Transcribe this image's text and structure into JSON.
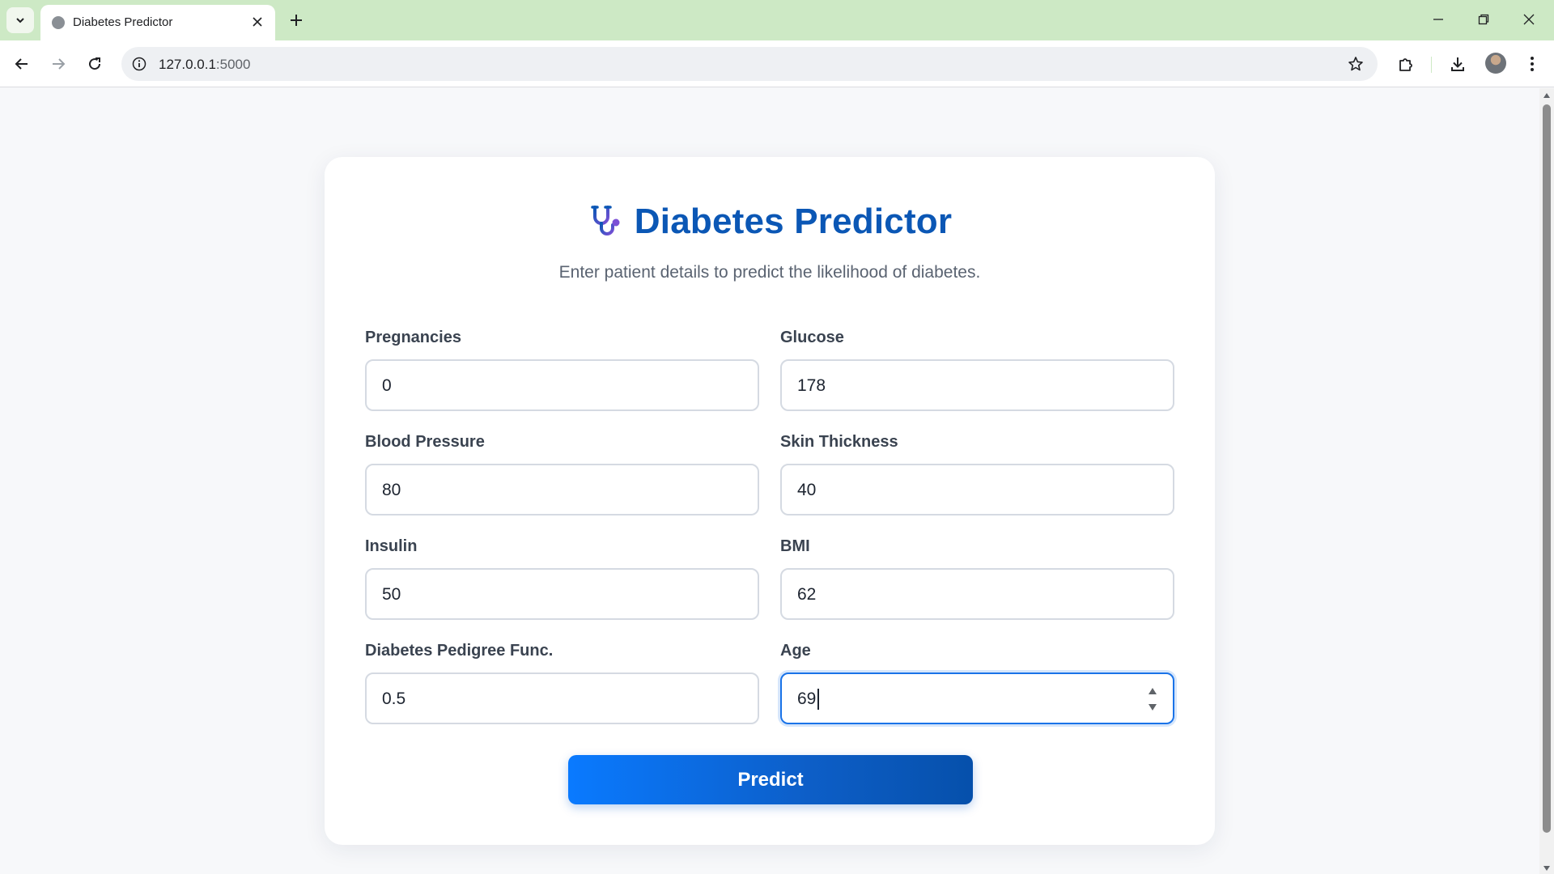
{
  "browser": {
    "tab_title": "Diabetes Predictor",
    "url_host": "127.0.0.1",
    "url_port": ":5000"
  },
  "page": {
    "title": "Diabetes Predictor",
    "subtitle": "Enter patient details to predict the likelihood of diabetes.",
    "title_icon": "stethoscope-icon",
    "accent_color": "#0b57b5",
    "fields": [
      {
        "label": "Pregnancies",
        "value": "0"
      },
      {
        "label": "Glucose",
        "value": "178"
      },
      {
        "label": "Blood Pressure",
        "value": "80"
      },
      {
        "label": "Skin Thickness",
        "value": "40"
      },
      {
        "label": "Insulin",
        "value": "50"
      },
      {
        "label": "BMI",
        "value": "62"
      },
      {
        "label": "Diabetes Pedigree Func.",
        "value": "0.5"
      },
      {
        "label": "Age",
        "value": "69"
      }
    ],
    "predict_label": "Predict"
  }
}
